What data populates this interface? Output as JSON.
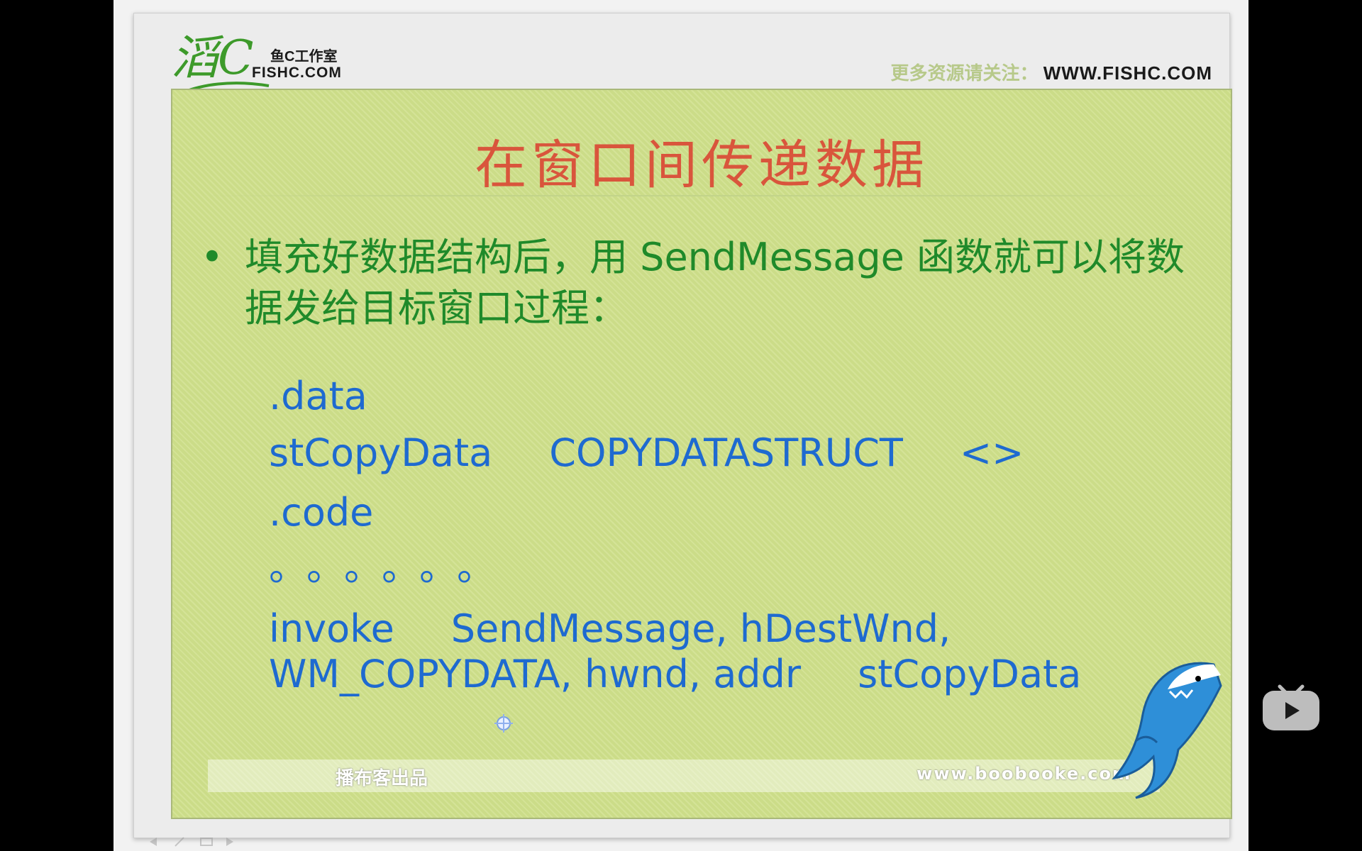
{
  "header": {
    "logo_mark": "滔C",
    "logo_cn": "鱼C工作室",
    "logo_en": "FISHC.COM",
    "banner_cn": "更多资源请关注：",
    "banner_url": "WWW.FISHC.COM"
  },
  "slide": {
    "title": "在窗口间传递数据",
    "bullet_dot": "•",
    "bullet_text": "填充好数据结构后，用 SendMessage 函数就可以将数据发给目标窗口过程：",
    "code": {
      "line1": ".data",
      "line2_a": "stCopyData",
      "line2_b": "COPYDATASTRUCT",
      "line2_c": "<>",
      "line3": ".code",
      "line4": "。。。。。。",
      "line5_a": "invoke",
      "line5_b": "SendMessage, hDestWnd,",
      "line6_a": "WM_COPYDATA, hwnd, addr",
      "line6_b": "stCopyData"
    }
  },
  "footer": {
    "left": "播布客出品",
    "right": "www.boobooke.com"
  },
  "icons": {
    "shark": "shark-mascot-icon",
    "play": "video-play-icon",
    "cursor": "cursor-sparkle-icon"
  },
  "colors": {
    "panel": "#cfe08b",
    "title": "#d9553c",
    "bullet": "#1f8a2a",
    "code": "#1e6ad0"
  }
}
